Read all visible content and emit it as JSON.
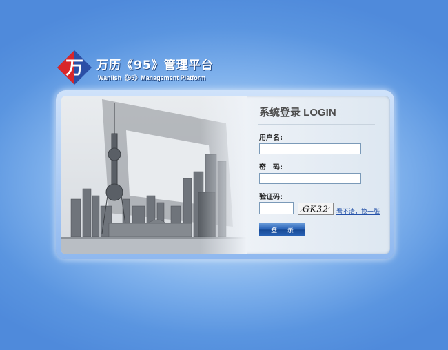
{
  "brand": {
    "title_cn": "万历《95》管理平台",
    "title_en": "Wanlish《95》Management Platform",
    "logo_char": "万"
  },
  "login": {
    "title": "系统登录 LOGIN",
    "username_label": "用户名:",
    "username_value": "",
    "password_label": "密　码:",
    "password_value": "",
    "captcha_label": "验证码:",
    "captcha_value": "",
    "captcha_image_text": "GK32",
    "refresh_link": "看不清，换一张",
    "submit_label": "登 录"
  },
  "colors": {
    "logo_red": "#d8262a",
    "logo_blue": "#2b4fa6",
    "button": "#2b64b8",
    "link": "#2451a8"
  }
}
